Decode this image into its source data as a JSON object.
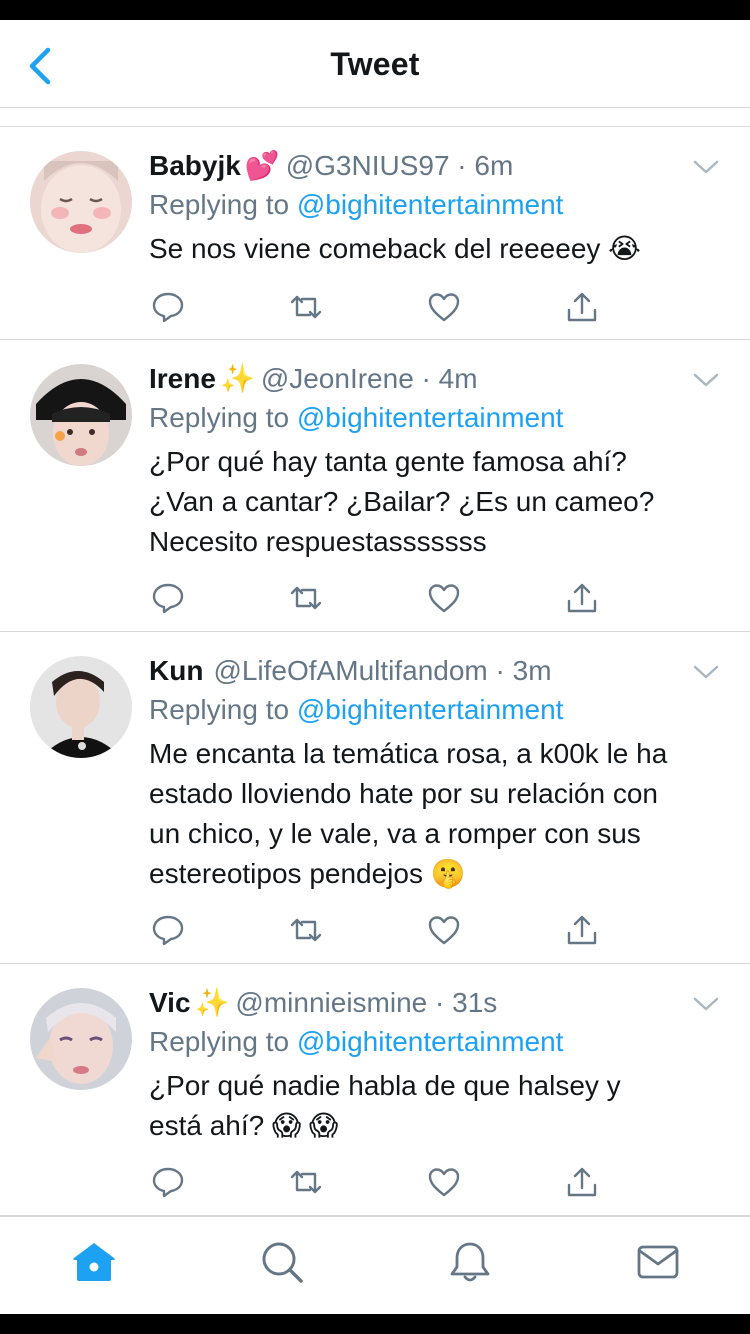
{
  "header": {
    "title": "Tweet"
  },
  "colors": {
    "accent": "#1da1f2",
    "secondary_text": "#657786",
    "divider": "#d6d9dc"
  },
  "icons": {
    "back": "chevron-left-icon",
    "reply": "reply-icon",
    "retweet": "retweet-icon",
    "like": "heart-icon",
    "share": "share-icon",
    "more": "chevron-down-icon"
  },
  "tweets": [
    {
      "name": "Babyjk",
      "name_deco": "💕",
      "handle": "@G3NIUS97",
      "time": "6m",
      "replying_prefix": "Replying to",
      "replying_to": "@bighitentertainment",
      "text": "Se nos viene comeback del reeeeey 😭"
    },
    {
      "name": "Irene",
      "name_deco": "✨",
      "handle": "@JeonIrene",
      "time": "4m",
      "replying_prefix": "Replying to",
      "replying_to": "@bighitentertainment",
      "text": "¿Por qué hay tanta gente famosa ahí?\n¿Van a cantar? ¿Bailar? ¿Es un cameo?\nNecesito respuestasssssss"
    },
    {
      "name": "Kun",
      "name_deco": "",
      "handle": "@LifeOfAMultifandom",
      "time": "3m",
      "replying_prefix": "Replying to",
      "replying_to": "@bighitentertainment",
      "text": "Me encanta la temática rosa, a k00k le ha\nestado lloviendo hate por su relación con\nun chico, y le vale, va a romper con sus\nestereotipos pendejos 🤫"
    },
    {
      "name": "Vic",
      "name_deco": "✨",
      "handle": "@minnieismine",
      "time": "31s",
      "replying_prefix": "Replying to",
      "replying_to": "@bighitentertainment",
      "text": "¿Por qué nadie habla de que halsey y\nestá ahí? 😱 😱"
    }
  ],
  "tabbar": {
    "items": [
      {
        "icon": "home-icon",
        "active": true
      },
      {
        "icon": "search-icon",
        "active": false
      },
      {
        "icon": "bell-icon",
        "active": false
      },
      {
        "icon": "mail-icon",
        "active": false
      }
    ]
  }
}
